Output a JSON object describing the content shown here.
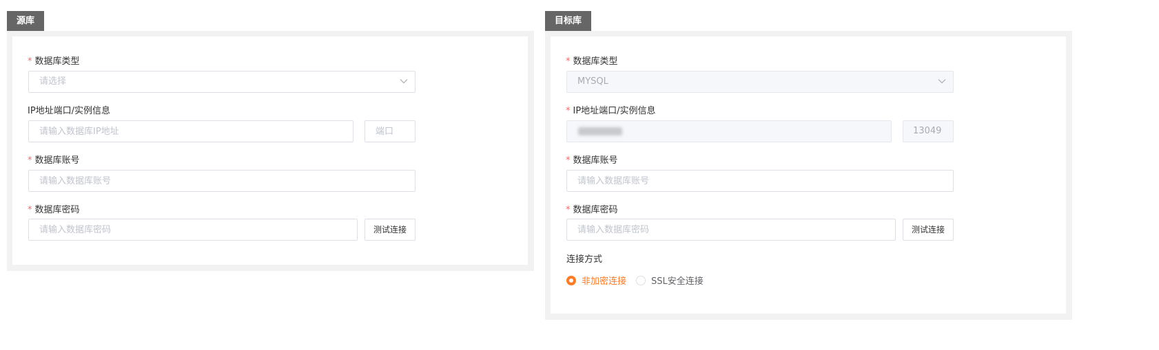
{
  "source": {
    "tab_title": "源库",
    "db_type_label": "数据库类型",
    "db_type_placeholder": "请选择",
    "ip_label": "IP地址端口/实例信息",
    "ip_placeholder": "请输入数据库IP地址",
    "port_placeholder": "端口",
    "account_label": "数据库账号",
    "account_placeholder": "请输入数据库账号",
    "password_label": "数据库密码",
    "password_placeholder": "请输入数据库密码",
    "test_button": "测试连接"
  },
  "target": {
    "tab_title": "目标库",
    "db_type_label": "数据库类型",
    "db_type_value": "MYSQL",
    "ip_label": "IP地址端口/实例信息",
    "port_value": "13049",
    "account_label": "数据库账号",
    "account_placeholder": "请输入数据库账号",
    "password_label": "数据库密码",
    "password_placeholder": "请输入数据库密码",
    "test_button": "测试连接",
    "connection_label": "连接方式",
    "connection_options": [
      {
        "label": "非加密连接",
        "checked": true
      },
      {
        "label": "SSL安全连接",
        "checked": false
      }
    ]
  },
  "required_mark": "*",
  "colors": {
    "accent": "#ff7a22",
    "required": "#f56c6c",
    "tab_bg": "#666666",
    "panel_bg": "#f2f2f2"
  },
  "icons": {
    "select_arrow": "chevron-down-icon"
  }
}
